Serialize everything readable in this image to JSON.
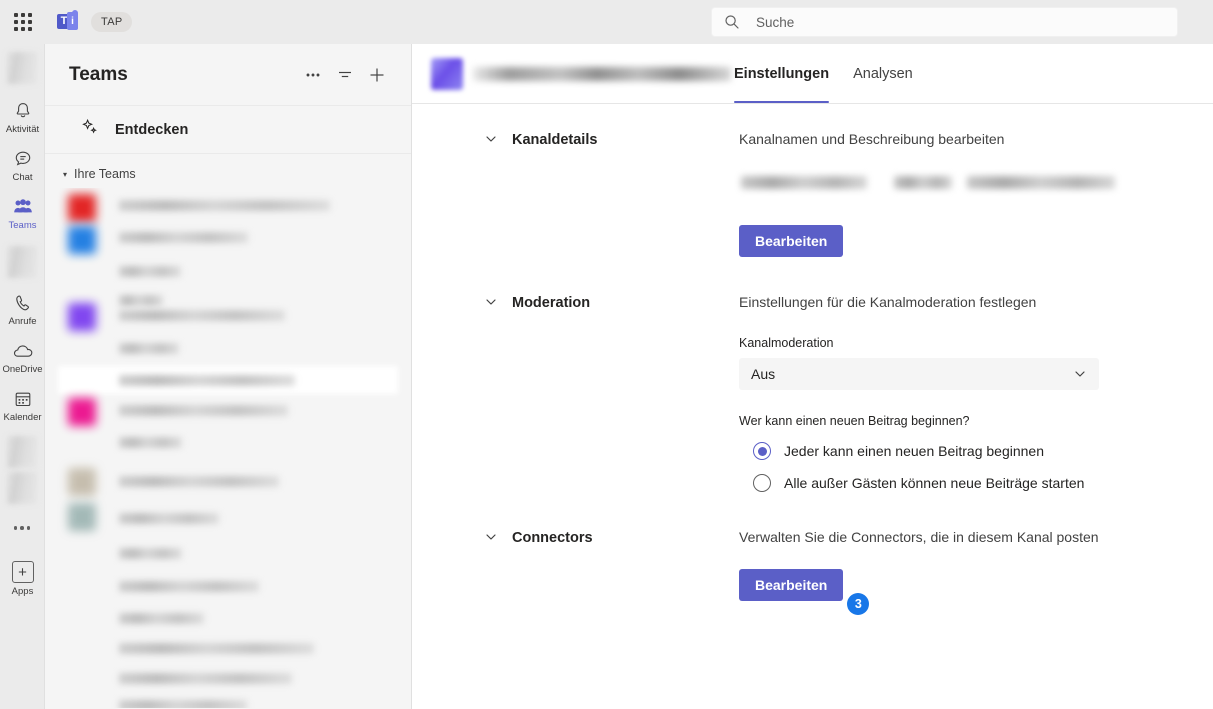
{
  "topbar": {
    "waffle_icon": "app-grid-icon",
    "logo_icon": "teams-logo-icon",
    "tenant_badge": "TAP",
    "search": {
      "placeholder": "Suche",
      "value": "",
      "icon": "search-icon"
    }
  },
  "rail": {
    "items": [
      {
        "label": "",
        "icon": "avatar-blurred",
        "type": "blur",
        "active": false
      },
      {
        "label": "Aktivität",
        "icon": "bell-icon",
        "type": "icon",
        "active": false
      },
      {
        "label": "Chat",
        "icon": "chat-icon",
        "type": "icon",
        "active": false
      },
      {
        "label": "Teams",
        "icon": "teams-icon",
        "type": "icon",
        "active": true
      },
      {
        "label": "",
        "icon": "blurred-app",
        "type": "blur",
        "active": false
      },
      {
        "label": "Anrufe",
        "icon": "phone-icon",
        "type": "icon",
        "active": false
      },
      {
        "label": "OneDrive",
        "icon": "cloud-icon",
        "type": "icon",
        "active": false
      },
      {
        "label": "Kalender",
        "icon": "calendar-icon",
        "type": "icon",
        "active": false
      },
      {
        "label": "",
        "icon": "blurred-app-2",
        "type": "blur",
        "active": false
      },
      {
        "label": "",
        "icon": "blurred-app-3",
        "type": "blur",
        "active": false
      }
    ],
    "more_icon": "ellipsis-icon",
    "apps": {
      "label": "Apps",
      "icon": "plus-box-icon"
    }
  },
  "panel": {
    "title": "Teams",
    "header_icons": [
      {
        "name": "more-options-icon",
        "glyph": "···"
      },
      {
        "name": "filter-icon",
        "glyph": "filter"
      },
      {
        "name": "join-or-create-team-icon",
        "glyph": "+"
      }
    ],
    "discover": {
      "label": "Entdecken",
      "icon": "discover-sparkle-icon"
    },
    "your_teams": {
      "label": "Ihre Teams",
      "caret": "▾"
    }
  },
  "main": {
    "channel_avatar": "channel-avatar-blurred",
    "channel_name": "",
    "tabs": [
      {
        "label": "Einstellungen",
        "active": true
      },
      {
        "label": "Analysen",
        "active": false
      }
    ],
    "sections": [
      {
        "title": "Kanaldetails",
        "description": "Kanalnamen und Beschreibung bearbeiten",
        "button": "Bearbeiten"
      },
      {
        "title": "Moderation",
        "description": "Einstellungen für die Kanalmoderation festlegen",
        "field_label": "Kanalmoderation",
        "dropdown_value": "Aus",
        "question": "Wer kann einen neuen Beitrag beginnen?",
        "options": [
          {
            "label": "Jeder kann einen neuen Beitrag beginnen",
            "selected": true
          },
          {
            "label": "Alle außer Gästen können neue Beiträge starten",
            "selected": false
          }
        ]
      },
      {
        "title": "Connectors",
        "description": "Verwalten Sie die Connectors, die in diesem Kanal posten",
        "button": "Bearbeiten",
        "step_badge": "3"
      }
    ]
  },
  "colors": {
    "accent": "#5b5fc7",
    "badge_blue": "#1877e8",
    "topbar_bg": "#ebebeb",
    "panel_bg": "#f5f5f5"
  }
}
